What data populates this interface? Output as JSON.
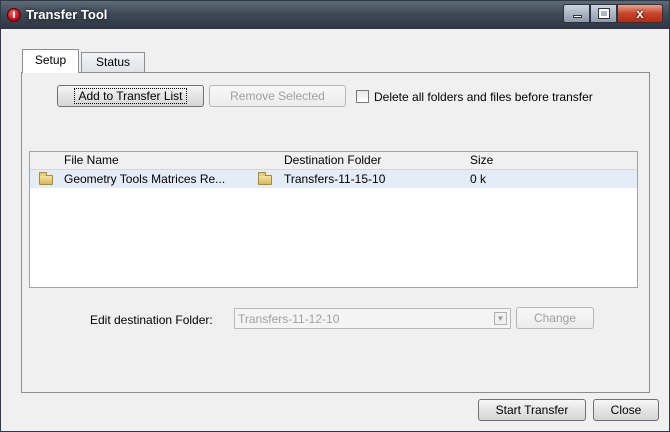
{
  "window": {
    "title": "Transfer Tool",
    "close_glyph": "x"
  },
  "tabs": [
    {
      "label": "Setup",
      "selected": true
    },
    {
      "label": "Status",
      "selected": false
    }
  ],
  "toolbar": {
    "add_label": "Add to Transfer List",
    "remove_label": "Remove Selected",
    "delete_checkbox_label": "Delete all folders and files before transfer",
    "delete_checked": false
  },
  "table": {
    "columns": [
      "File Name",
      "Destination Folder",
      "Size"
    ],
    "rows": [
      {
        "file_name": "Geometry Tools  Matrices Re...",
        "destination": "Transfers-11-15-10",
        "size": "0 k"
      }
    ]
  },
  "destination": {
    "label": "Edit destination Folder:",
    "value": "Transfers-11-12-10",
    "change_label": "Change"
  },
  "footer": {
    "start_label": "Start Transfer",
    "close_label": "Close"
  },
  "icons": {
    "folder": "folder-icon",
    "dropdown": "chevron-down-icon"
  }
}
